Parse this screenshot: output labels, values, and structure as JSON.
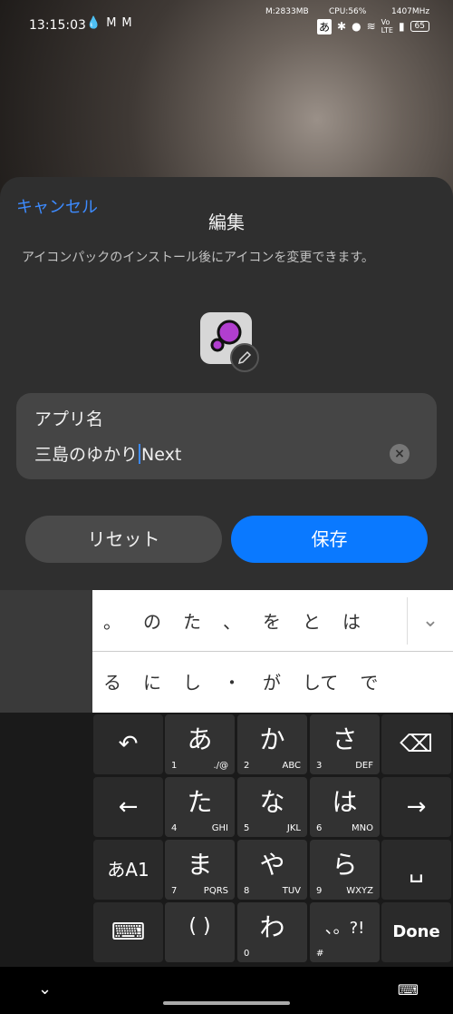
{
  "status": {
    "time": "13:15:03",
    "memory": "M:2833MB",
    "cpu": "CPU:56%",
    "freq": "1407MHz",
    "ime": "あ",
    "battery": "65",
    "icons": [
      "drop-icon",
      "gmail-icon",
      "gmail-icon",
      "bluetooth-icon",
      "location-icon",
      "wifi-icon",
      "volte-icon",
      "signal-icon"
    ]
  },
  "sheet": {
    "cancel": "キャンセル",
    "title": "編集",
    "hint": "アイコンパックのインストール後にアイコンを変更できます。",
    "field_label": "アプリ名",
    "field_value_before": "三島のゆかり",
    "field_value_after": "Next",
    "reset": "リセット",
    "save": "保存"
  },
  "candidates": {
    "row1": [
      "。",
      "の",
      "た",
      "、",
      "を",
      "と",
      "は"
    ],
    "row2": [
      "る",
      "に",
      "し",
      "・",
      "が",
      "して",
      "で"
    ]
  },
  "keys": {
    "a": {
      "main": "あ",
      "num": "1",
      "sub": "./@"
    },
    "ka": {
      "main": "か",
      "num": "2",
      "sub": "ABC"
    },
    "sa": {
      "main": "さ",
      "num": "3",
      "sub": "DEF"
    },
    "ta": {
      "main": "た",
      "num": "4",
      "sub": "GHI"
    },
    "na": {
      "main": "な",
      "num": "5",
      "sub": "JKL"
    },
    "ha": {
      "main": "は",
      "num": "6",
      "sub": "MNO"
    },
    "ma": {
      "main": "ま",
      "num": "7",
      "sub": "PQRS"
    },
    "ya": {
      "main": "や",
      "num": "8",
      "sub": "TUV"
    },
    "ra": {
      "main": "ら",
      "num": "9",
      "sub": "WXYZ"
    },
    "paren": {
      "main": "( )"
    },
    "wa": {
      "main": "わ",
      "num": "0"
    },
    "punct": {
      "main": "、。?!",
      "num": "#"
    },
    "mode": "あA1",
    "done": "Done"
  }
}
